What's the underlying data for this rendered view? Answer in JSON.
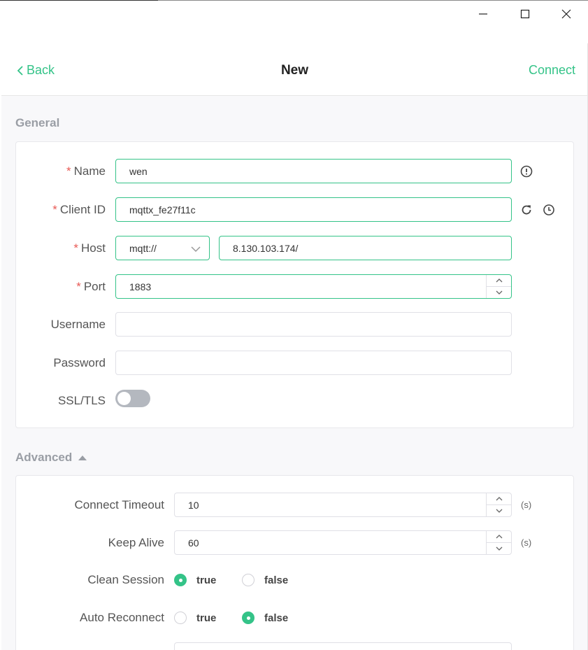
{
  "header": {
    "back_label": "Back",
    "title": "New",
    "connect_label": "Connect"
  },
  "general": {
    "section_title": "General",
    "name": {
      "label": "Name",
      "value": "wen"
    },
    "client_id": {
      "label": "Client ID",
      "value": "mqttx_fe27f11c"
    },
    "host": {
      "label": "Host",
      "protocol": "mqtt://",
      "value": "8.130.103.174/"
    },
    "port": {
      "label": "Port",
      "value": "1883"
    },
    "username": {
      "label": "Username",
      "value": ""
    },
    "password": {
      "label": "Password",
      "value": ""
    },
    "ssl": {
      "label": "SSL/TLS",
      "enabled": false
    }
  },
  "advanced": {
    "section_title": "Advanced",
    "connect_timeout": {
      "label": "Connect Timeout",
      "value": "10",
      "unit": "(s)"
    },
    "keep_alive": {
      "label": "Keep Alive",
      "value": "60",
      "unit": "(s)"
    },
    "clean_session": {
      "label": "Clean Session",
      "true_label": "true",
      "false_label": "false",
      "selected": "true"
    },
    "auto_reconnect": {
      "label": "Auto Reconnect",
      "true_label": "true",
      "false_label": "false",
      "selected": "false"
    }
  },
  "colors": {
    "accent": "#34c388",
    "required": "#e85a55",
    "section": "#9a9ea5"
  }
}
